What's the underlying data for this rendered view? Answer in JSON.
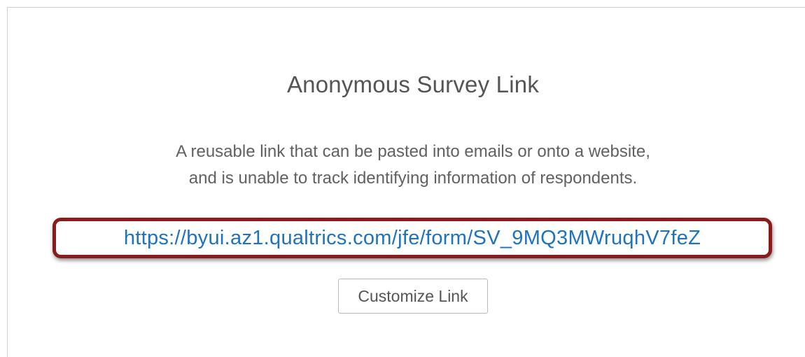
{
  "dialog": {
    "title": "Anonymous Survey Link",
    "description_line1": "A reusable link that can be pasted into emails or onto a website,",
    "description_line2": "and is unable to track identifying information of respondents.",
    "survey_url": "https://byui.az1.qualtrics.com/jfe/form/SV_9MQ3MWruqhV7feZ",
    "customize_button_label": "Customize Link"
  },
  "colors": {
    "link": "#1e73be",
    "highlight_border": "#8b1a1a",
    "text": "#555555"
  }
}
